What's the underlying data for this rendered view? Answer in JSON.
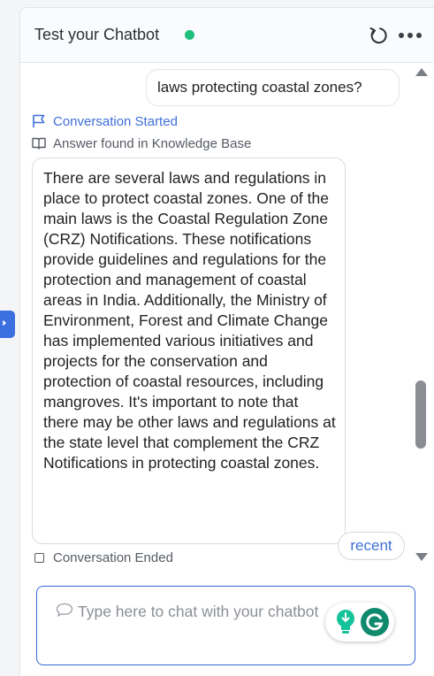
{
  "header": {
    "title": "Test your Chatbot",
    "status": "online"
  },
  "conversation": {
    "user_message": "laws protecting coastal zones?",
    "status_started": "Conversation Started",
    "status_source": "Answer found in Knowledge Base",
    "bot_message": "There are several laws and regulations in place to protect coastal zones. One of the main laws is the Coastal Regulation Zone (CRZ) Notifications. These notifications provide guidelines and regulations for the protection and management of coastal areas in India. Additionally, the Ministry of Environment, Forest and Climate Change has implemented various initiatives and projects for the conservation and protection of coastal resources, including mangroves. It's important to note that there may be other laws and regulations at the state level that complement the CRZ Notifications in protecting coastal zones.",
    "status_ended": "Conversation Ended",
    "recent_label": "recent"
  },
  "composer": {
    "placeholder": "Type here to chat with your chatbot"
  },
  "icons": {
    "refresh": "refresh-icon",
    "more": "more-icon",
    "flag": "flag-icon",
    "book": "book-icon",
    "chat": "chat-bubble-icon",
    "bulb": "lightbulb-icon",
    "grammarly": "grammarly-icon"
  },
  "colors": {
    "accent": "#3e6fd8",
    "online": "#1fbf7c",
    "composer_border": "#3566d6",
    "grammarly": "#15c39a"
  }
}
